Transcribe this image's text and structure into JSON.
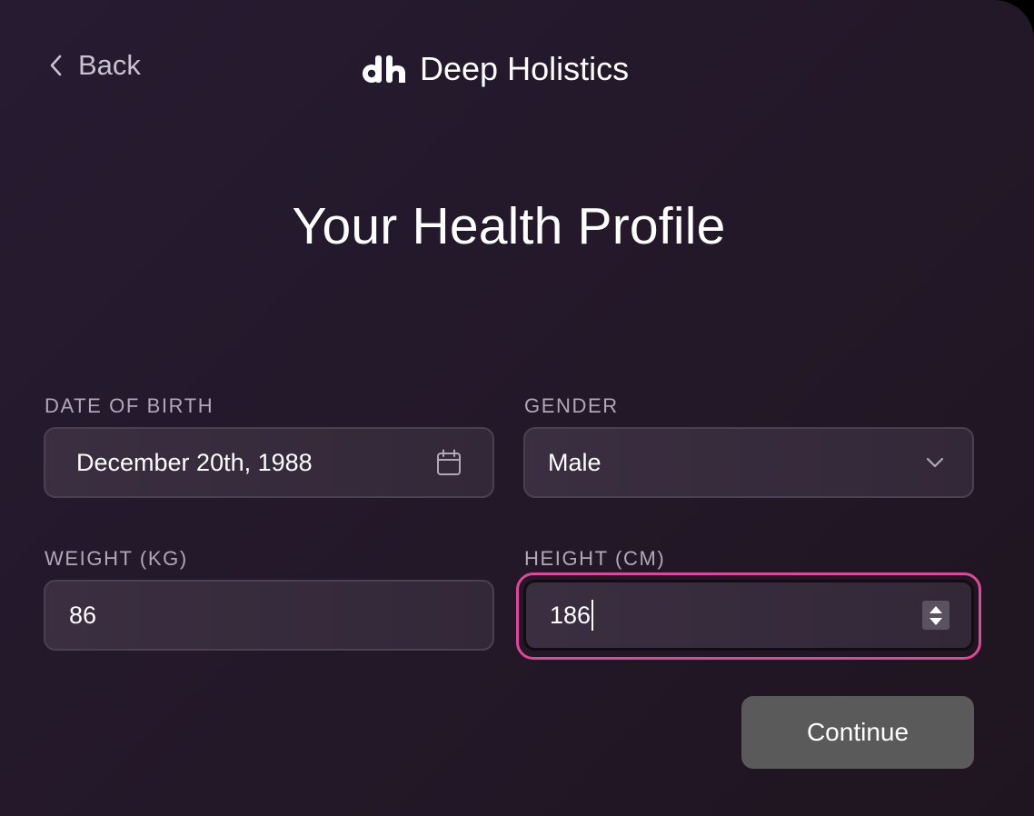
{
  "nav": {
    "back_label": "Back",
    "back_icon": "chevron-left-icon"
  },
  "brand": {
    "logo_icon": "deep-holistics-logo",
    "name": "Deep Holistics"
  },
  "page": {
    "title": "Your Health Profile"
  },
  "form": {
    "dob": {
      "label": "DATE OF BIRTH",
      "value": "December 20th, 1988",
      "icon": "calendar-icon"
    },
    "gender": {
      "label": "GENDER",
      "value": "Male",
      "icon": "chevron-down-icon"
    },
    "weight": {
      "label": "WEIGHT (KG)",
      "value": "86"
    },
    "height": {
      "label": "HEIGHT (CM)",
      "value": "186",
      "icon": "number-stepper-icon"
    },
    "continue_label": "Continue"
  },
  "colors": {
    "background": "#241a2c",
    "field_background": "#372b3d",
    "focus_ring": "#e0479b",
    "button_disabled": "#5a5a5a",
    "label": "#b1a8b7"
  }
}
